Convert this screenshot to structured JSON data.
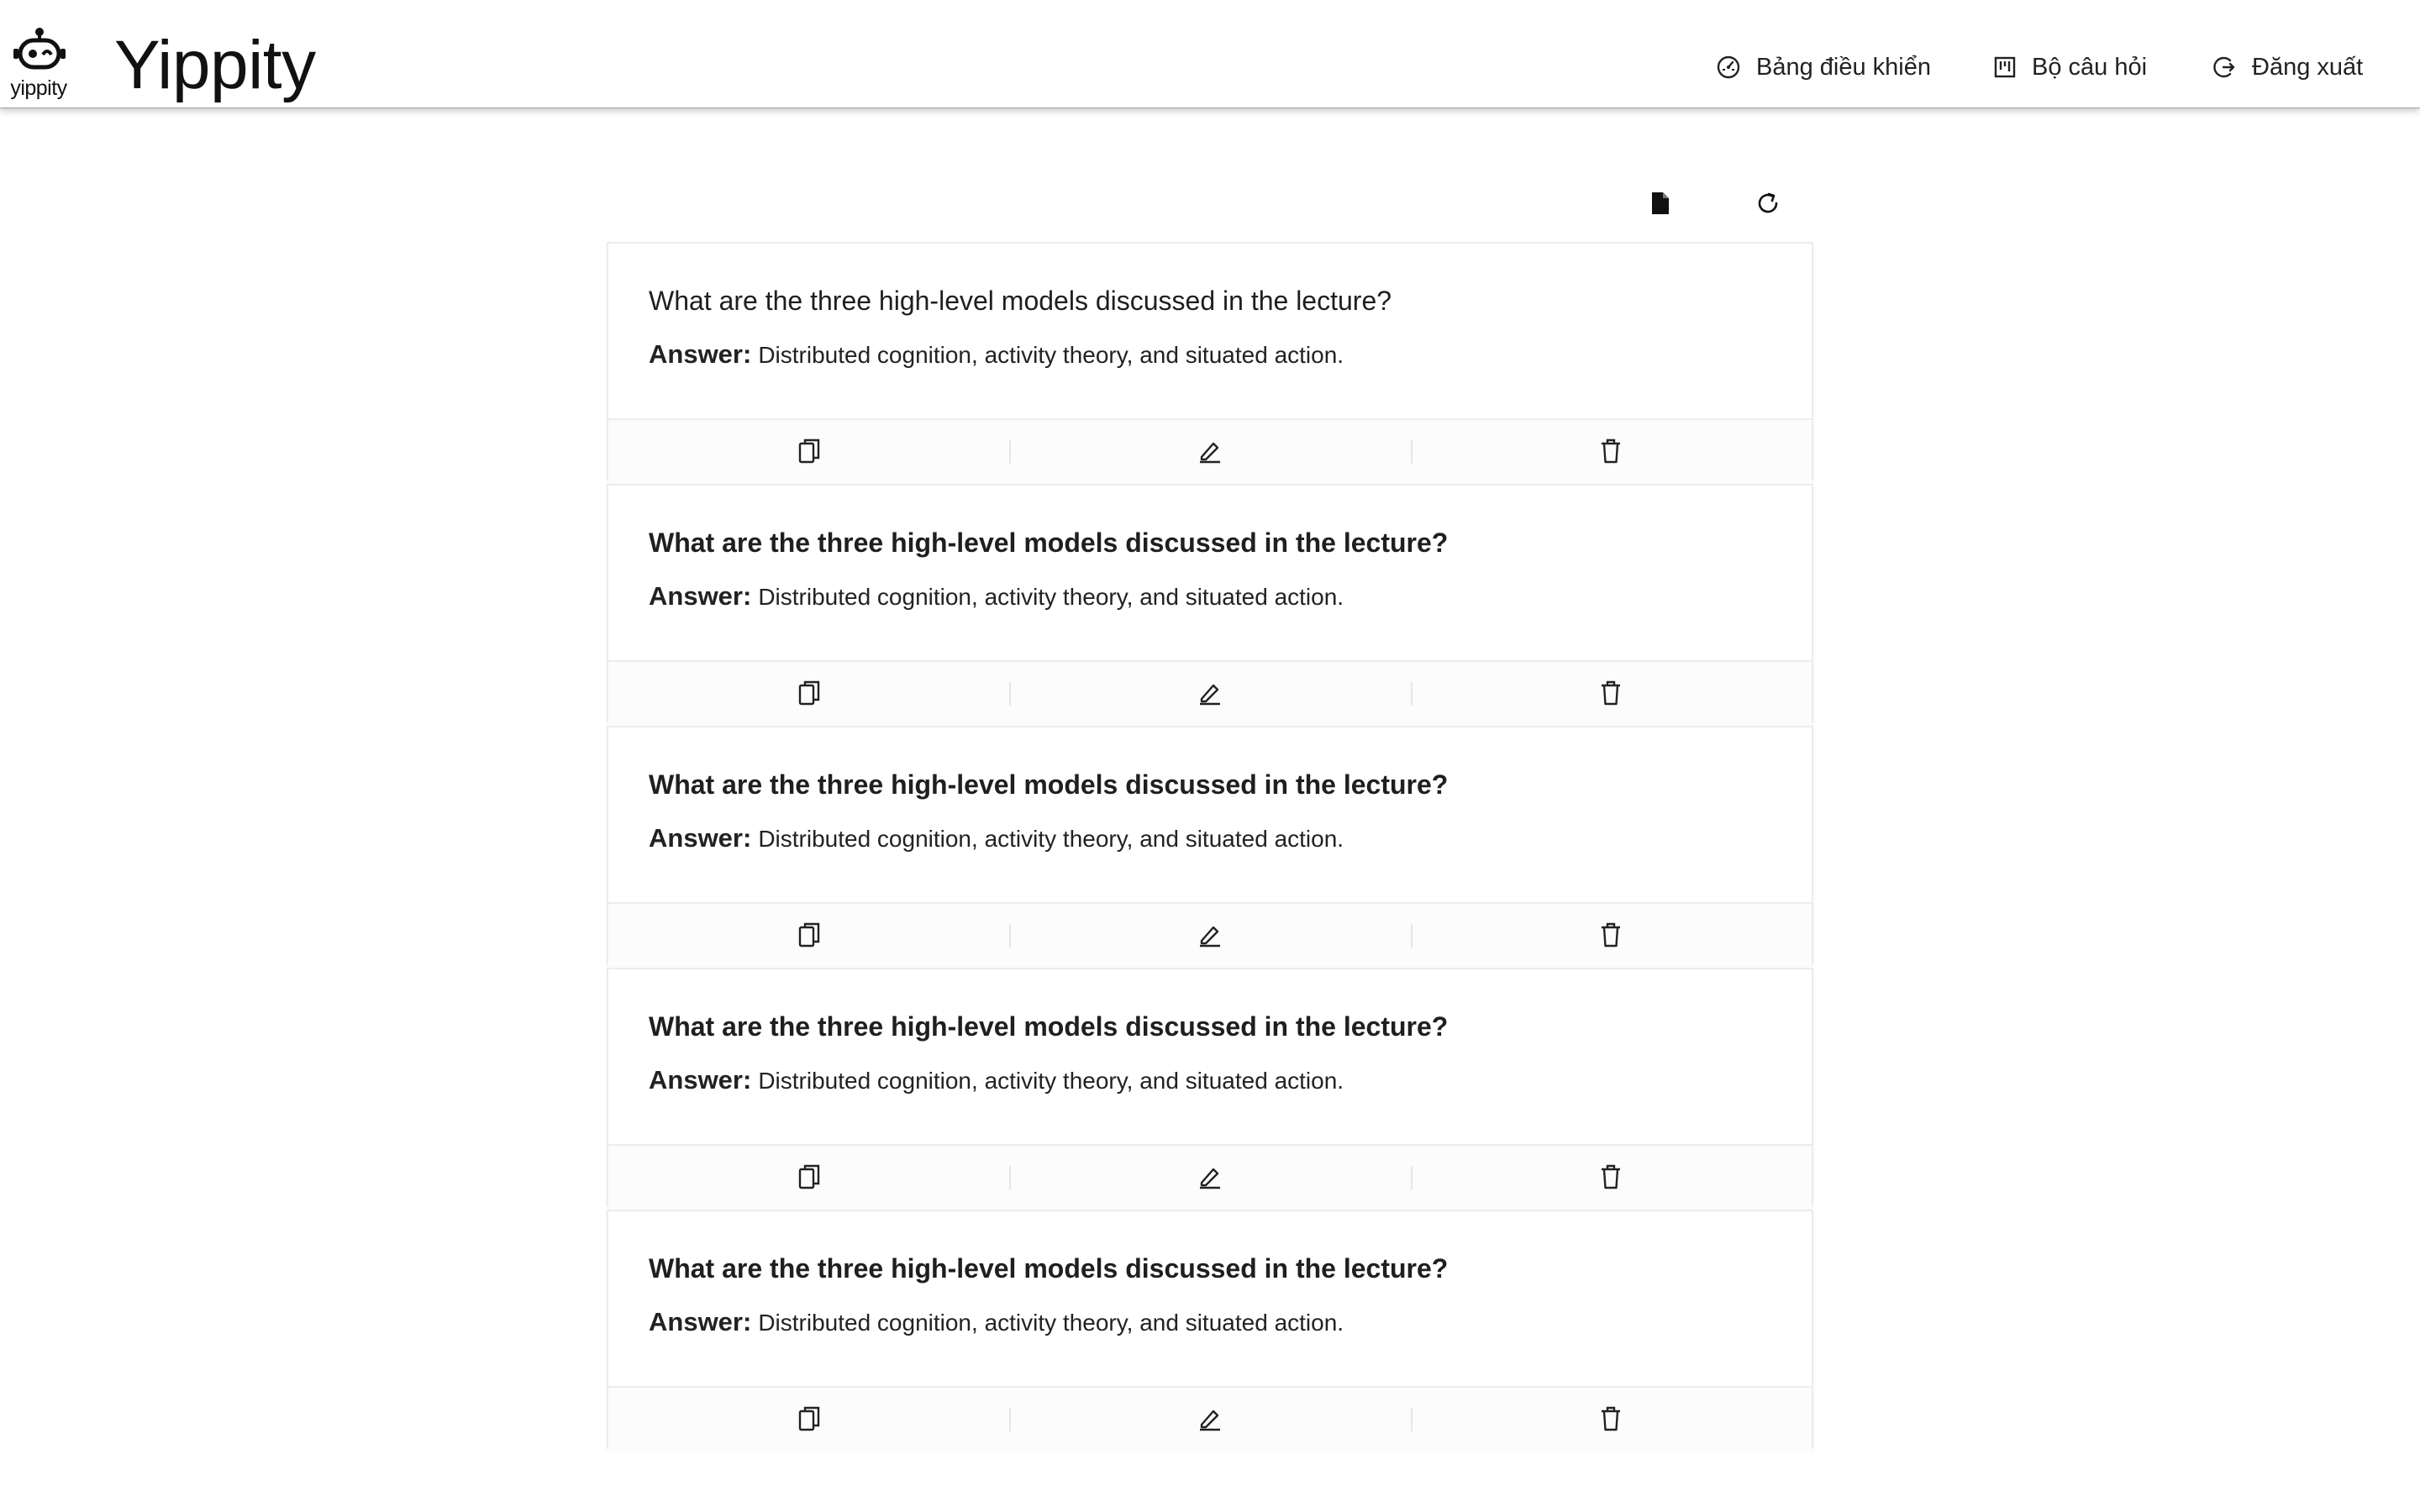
{
  "header": {
    "logo_text": "yippity",
    "brand": "Yippity",
    "nav": [
      {
        "label": "Bảng điều khiển",
        "icon": "dashboard-gauge-icon"
      },
      {
        "label": "Bộ câu hỏi",
        "icon": "quiz-board-icon"
      },
      {
        "label": "Đăng xuất",
        "icon": "logout-icon"
      }
    ]
  },
  "toolbar": {
    "icons": [
      "file-icon",
      "refresh-icon"
    ]
  },
  "cards": [
    {
      "question": "What are the three high-level models discussed in the lecture?",
      "answer_label": "Answer:",
      "answer": "Distributed cognition, activity theory, and situated action."
    },
    {
      "question": "What are the three high-level models discussed in the lecture?",
      "answer_label": "Answer:",
      "answer": "Distributed cognition, activity theory, and situated action."
    },
    {
      "question": "What are the three high-level models discussed in the lecture?",
      "answer_label": "Answer:",
      "answer": "Distributed cognition, activity theory, and situated action."
    },
    {
      "question": "What are the three high-level models discussed in the lecture?",
      "answer_label": "Answer:",
      "answer": "Distributed cognition, activity theory, and situated action."
    },
    {
      "question": "What are the three high-level models discussed in the lecture?",
      "answer_label": "Answer:",
      "answer": "Distributed cognition, activity theory, and situated action."
    }
  ],
  "card_actions": [
    "copy-icon",
    "edit-pencil-icon",
    "trash-icon"
  ],
  "colors": {
    "border": "#ececec",
    "text": "#1f1f1f",
    "background": "#ffffff"
  }
}
